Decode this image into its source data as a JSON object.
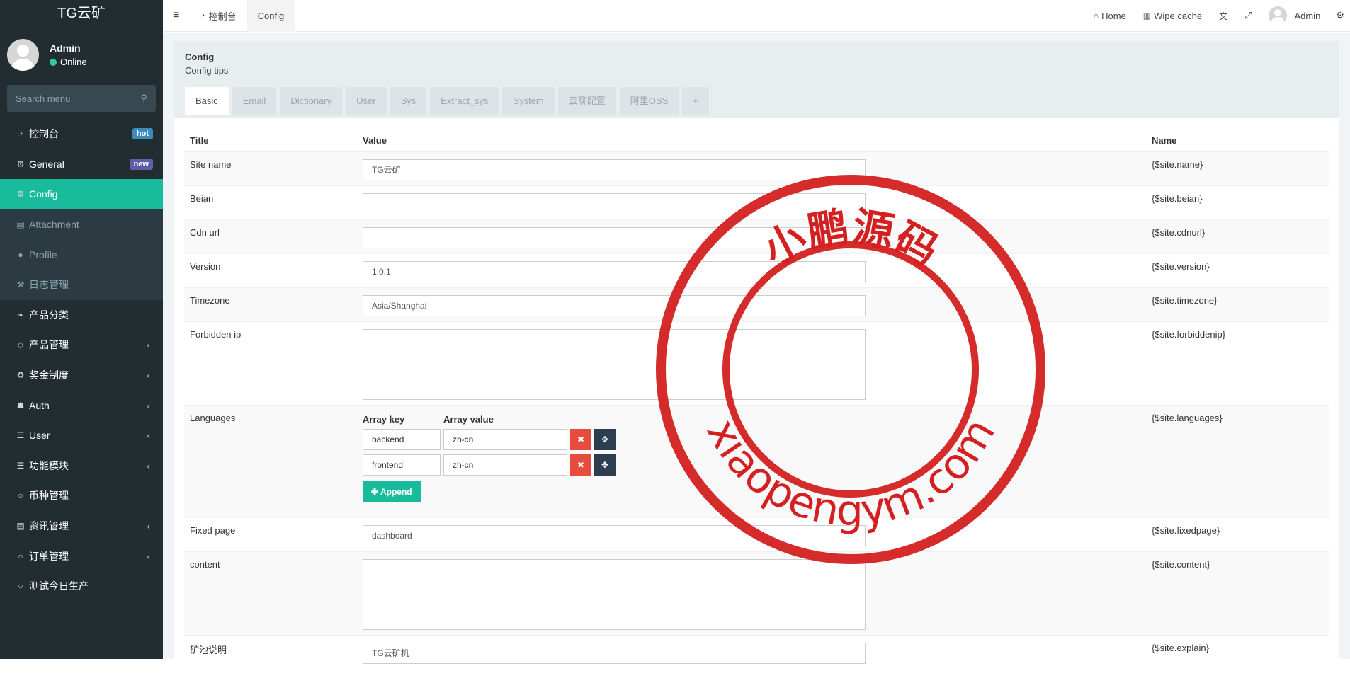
{
  "sidebar": {
    "logo": "TG云矿",
    "user": {
      "name": "Admin",
      "status": "Online"
    },
    "search_placeholder": "Search menu",
    "items": [
      {
        "label": "控制台",
        "icon": "dashboard-icon",
        "glyph": "◔",
        "badge": "hot",
        "badge_color": "#3c8dbc"
      },
      {
        "label": "General",
        "icon": "cogs-icon",
        "glyph": "⚙",
        "badge": "new",
        "badge_color": "#605ca8"
      },
      {
        "label": "Config",
        "icon": "cog-icon",
        "glyph": "⚙",
        "active": true
      },
      {
        "label": "Attachment",
        "icon": "file-image-icon",
        "glyph": "▤",
        "sub": true
      },
      {
        "label": "Profile",
        "icon": "user-icon",
        "glyph": "●",
        "sub": true
      },
      {
        "label": "日志管理",
        "icon": "log-icon",
        "glyph": "⚒",
        "sub": true
      },
      {
        "label": "产品分类",
        "icon": "leaf-icon",
        "glyph": "❧"
      },
      {
        "label": "产品管理",
        "icon": "diamond-icon",
        "glyph": "◇",
        "arrow": "‹"
      },
      {
        "label": "奖金制度",
        "icon": "recycle-icon",
        "glyph": "♻",
        "arrow": "‹"
      },
      {
        "label": "Auth",
        "icon": "group-icon",
        "glyph": "☗",
        "arrow": "‹"
      },
      {
        "label": "User",
        "icon": "list-icon",
        "glyph": "☰",
        "arrow": "‹"
      },
      {
        "label": "功能模块",
        "icon": "list-icon",
        "glyph": "☰",
        "arrow": "‹"
      },
      {
        "label": "币种管理",
        "icon": "circle-icon",
        "glyph": "○"
      },
      {
        "label": "资讯管理",
        "icon": "newspaper-icon",
        "glyph": "▤",
        "arrow": "‹"
      },
      {
        "label": "订单管理",
        "icon": "circle-icon",
        "glyph": "○",
        "arrow": "‹"
      },
      {
        "label": "测试今日生产",
        "icon": "circle-icon",
        "glyph": "○"
      }
    ]
  },
  "topbar": {
    "tabs": [
      {
        "label": "控制台",
        "icon": "dashboard-icon"
      },
      {
        "label": "Config",
        "active": true
      }
    ],
    "right": {
      "home": "Home",
      "wipe": "Wipe cache",
      "admin": "Admin"
    }
  },
  "panel": {
    "title": "Config",
    "tips": "Config tips",
    "tabs": [
      "Basic",
      "Email",
      "Dictionary",
      "User",
      "Sys",
      "Extract_sys",
      "System",
      "云聊配置",
      "阿里OSS",
      "+"
    ]
  },
  "table": {
    "headers": {
      "title": "Title",
      "value": "Value",
      "name": "Name"
    },
    "rows": [
      {
        "title": "Site name",
        "value": "TG云矿",
        "name": "{$site.name}",
        "type": "input"
      },
      {
        "title": "Beian",
        "value": "",
        "name": "{$site.beian}",
        "type": "input"
      },
      {
        "title": "Cdn url",
        "value": "",
        "name": "{$site.cdnurl}",
        "type": "input"
      },
      {
        "title": "Version",
        "value": "1.0.1",
        "name": "{$site.version}",
        "type": "input"
      },
      {
        "title": "Timezone",
        "value": "Asia/Shanghai",
        "name": "{$site.timezone}",
        "type": "input"
      },
      {
        "title": "Forbidden ip",
        "value": "",
        "name": "{$site.forbiddenip}",
        "type": "textarea"
      },
      {
        "title": "Languages",
        "name": "{$site.languages}",
        "type": "array"
      },
      {
        "title": "Fixed page",
        "value": "dashboard",
        "name": "{$site.fixedpage}",
        "type": "input"
      },
      {
        "title": "content",
        "value": "",
        "name": "{$site.content}",
        "type": "textarea"
      },
      {
        "title": "矿池说明",
        "value": "TG云矿机",
        "name": "{$site.explain}",
        "type": "input"
      }
    ],
    "languages": {
      "key_header": "Array key",
      "value_header": "Array value",
      "pairs": [
        {
          "key": "backend",
          "value": "zh-cn"
        },
        {
          "key": "frontend",
          "value": "zh-cn"
        }
      ],
      "append_label": "Append"
    }
  },
  "watermark": {
    "top_text": "小鹏源码",
    "bottom_text": "xiaopengym.com",
    "color": "#d42020"
  }
}
